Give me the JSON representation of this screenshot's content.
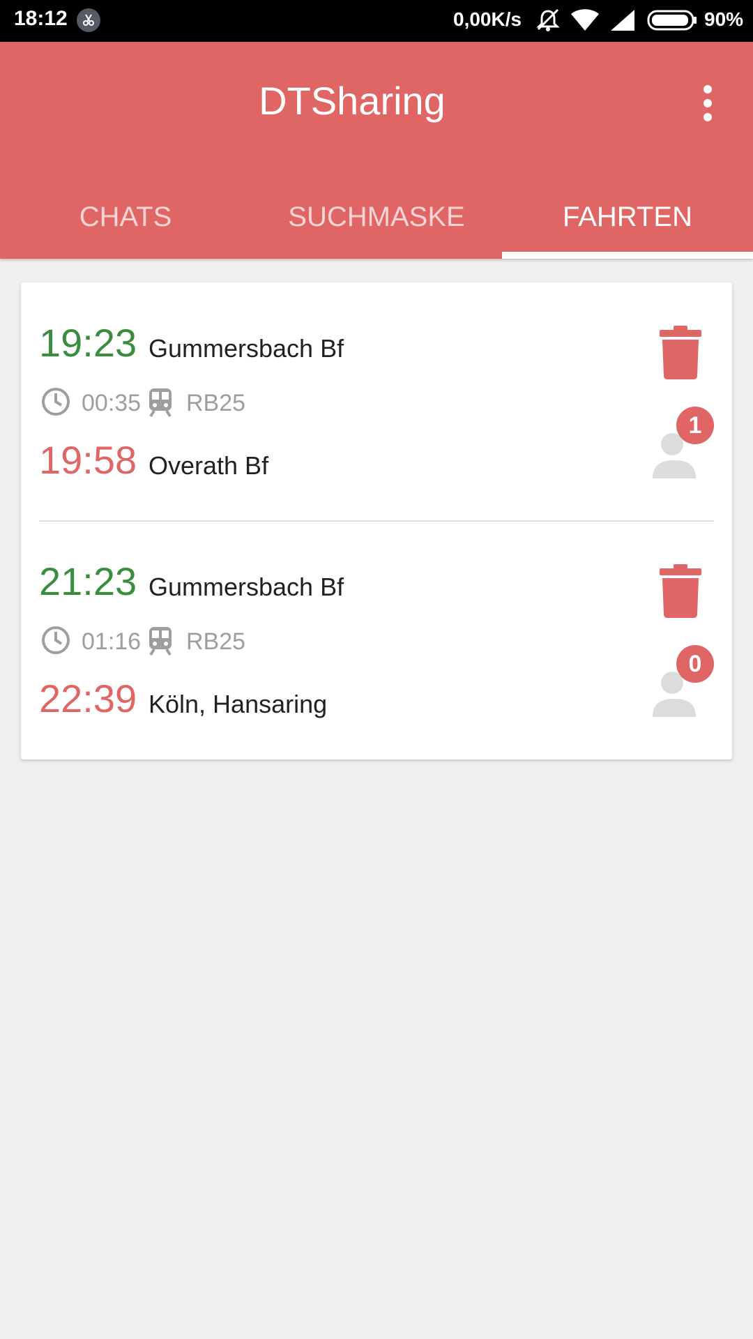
{
  "status_bar": {
    "time": "18:12",
    "network_speed": "0,00K/s",
    "battery": "90%",
    "icons": [
      "app-notification-icon",
      "vibrate-off-icon",
      "wifi-icon",
      "signal-icon",
      "battery-icon"
    ]
  },
  "app_bar": {
    "title": "DTSharing",
    "menu_icon": "more-vert-icon"
  },
  "tabs": [
    {
      "label": "CHATS",
      "active": false
    },
    {
      "label": "SUCHMASKE",
      "active": false
    },
    {
      "label": "FAHRTEN",
      "active": true
    }
  ],
  "trips": [
    {
      "departure_time": "19:23",
      "departure_station": "Gummersbach Bf",
      "duration": "00:35",
      "line": "RB25",
      "arrival_time": "19:58",
      "arrival_station": "Overath Bf",
      "passenger_count": "1"
    },
    {
      "departure_time": "21:23",
      "departure_station": "Gummersbach Bf",
      "duration": "01:16",
      "line": "RB25",
      "arrival_time": "22:39",
      "arrival_station": "Köln, Hansaring",
      "passenger_count": "0"
    }
  ],
  "colors": {
    "primary": "#e06666",
    "departure": "#388e3c",
    "arrival": "#e06666",
    "muted": "#9e9e9e",
    "background": "#efefef"
  }
}
